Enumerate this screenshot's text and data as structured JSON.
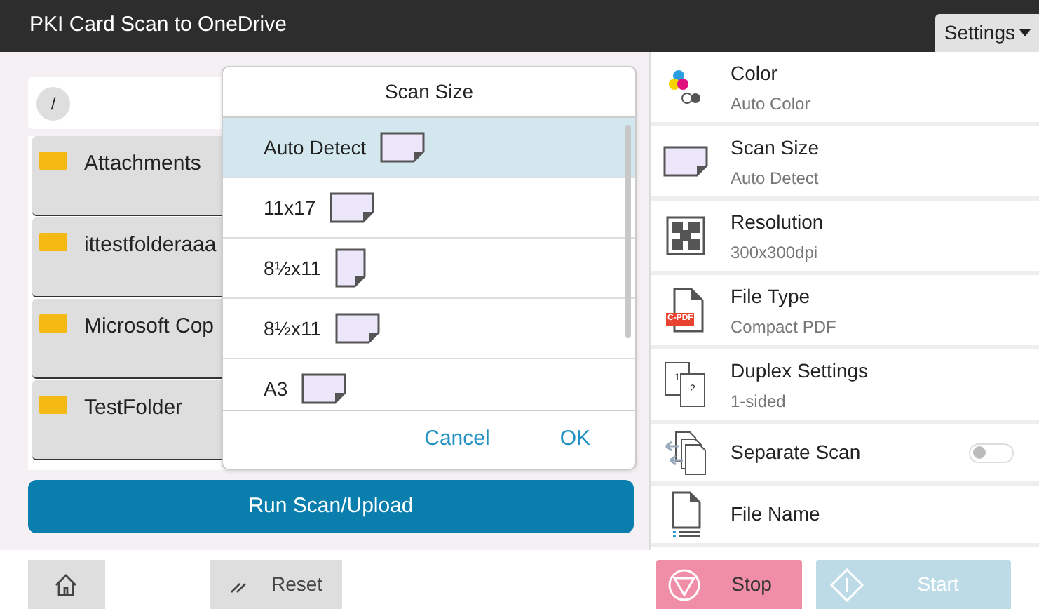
{
  "window": {
    "title": "PKI Card Scan to OneDrive"
  },
  "settings_menu": {
    "label": "Settings"
  },
  "path": {
    "label": "/"
  },
  "folders": [
    {
      "name": "Attachments"
    },
    {
      "name": "ittestfolderaaa"
    },
    {
      "name": "Microsoft Cop"
    },
    {
      "name": "TestFolder"
    }
  ],
  "run_button": {
    "label": "Run Scan/Upload"
  },
  "settings": [
    {
      "kind": "detail",
      "title": "Color",
      "value": "Auto Color"
    },
    {
      "kind": "detail",
      "title": "Scan Size",
      "value": "Auto Detect"
    },
    {
      "kind": "detail",
      "title": "Resolution",
      "value": "300x300dpi"
    },
    {
      "kind": "detail",
      "title": "File Type",
      "value": "Compact PDF",
      "badge": "C-PDF"
    },
    {
      "kind": "detail",
      "title": "Duplex Settings",
      "value": "1-sided",
      "page_numbers": [
        "1",
        "2"
      ]
    },
    {
      "kind": "toggle",
      "title": "Separate Scan",
      "on": false
    },
    {
      "kind": "simple",
      "title": "File Name"
    }
  ],
  "dialog": {
    "title": "Scan Size",
    "options": [
      {
        "label": "Auto Detect",
        "kind": "landscape",
        "selected": true
      },
      {
        "label": "11x17",
        "kind": "landscape",
        "selected": false
      },
      {
        "label": "8½x11",
        "kind": "portrait",
        "selected": false
      },
      {
        "label": "8½x11",
        "kind": "landscape",
        "selected": false
      },
      {
        "label": "A3",
        "kind": "landscape",
        "selected": false
      }
    ],
    "buttons": [
      "Cancel",
      "OK"
    ]
  },
  "bottom_bar": {
    "reset": "Reset",
    "stop": "Stop",
    "start": "Start",
    "start_disabled": true
  }
}
